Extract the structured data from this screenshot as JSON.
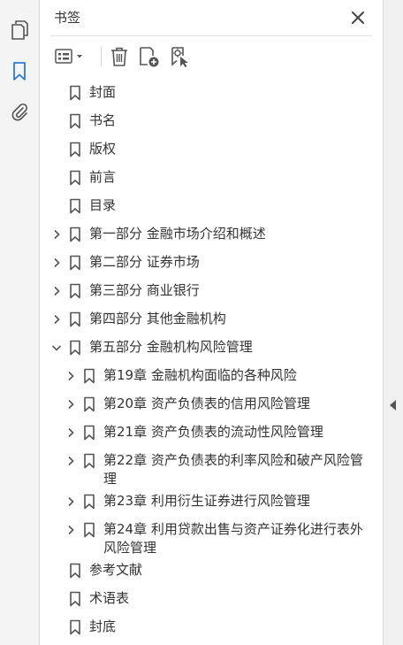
{
  "panel": {
    "title": "书签"
  },
  "rail": {
    "items": [
      {
        "icon": "pages-icon",
        "active": false
      },
      {
        "icon": "bookmark-icon",
        "active": true
      },
      {
        "icon": "attachment-icon",
        "active": false
      }
    ]
  },
  "toolbar": {
    "items": [
      "options-menu-icon",
      "delete-icon",
      "new-bookmark-icon",
      "bookmark-from-selection-icon"
    ]
  },
  "colors": {
    "accent": "#2d7bd6",
    "icon": "#555555",
    "text": "#333333"
  },
  "bookmarks": [
    {
      "label": "封面",
      "level": 0,
      "expander": "none"
    },
    {
      "label": "书名",
      "level": 0,
      "expander": "none"
    },
    {
      "label": "版权",
      "level": 0,
      "expander": "none"
    },
    {
      "label": "前言",
      "level": 0,
      "expander": "none"
    },
    {
      "label": "目录",
      "level": 0,
      "expander": "none"
    },
    {
      "label": "第一部分  金融市场介绍和概述",
      "level": 0,
      "expander": "collapsed"
    },
    {
      "label": "第二部分  证券市场",
      "level": 0,
      "expander": "collapsed"
    },
    {
      "label": "第三部分  商业银行",
      "level": 0,
      "expander": "collapsed"
    },
    {
      "label": "第四部分  其他金融机构",
      "level": 0,
      "expander": "collapsed"
    },
    {
      "label": "第五部分  金融机构风险管理",
      "level": 0,
      "expander": "expanded"
    },
    {
      "label": "第19章  金融机构面临的各种风险",
      "level": 1,
      "expander": "collapsed"
    },
    {
      "label": "第20章  资产负债表的信用风险管理",
      "level": 1,
      "expander": "collapsed"
    },
    {
      "label": "第21章  资产负债表的流动性风险管理",
      "level": 1,
      "expander": "collapsed"
    },
    {
      "label": "第22章  资产负债表的利率风险和破产风险管理",
      "level": 1,
      "expander": "collapsed"
    },
    {
      "label": "第23章  利用衍生证券进行风险管理",
      "level": 1,
      "expander": "collapsed"
    },
    {
      "label": "第24章  利用贷款出售与资产证券化进行表外风险管理",
      "level": 1,
      "expander": "collapsed"
    },
    {
      "label": "参考文献",
      "level": 0,
      "expander": "none"
    },
    {
      "label": "术语表",
      "level": 0,
      "expander": "none"
    },
    {
      "label": "封底",
      "level": 0,
      "expander": "none"
    }
  ]
}
